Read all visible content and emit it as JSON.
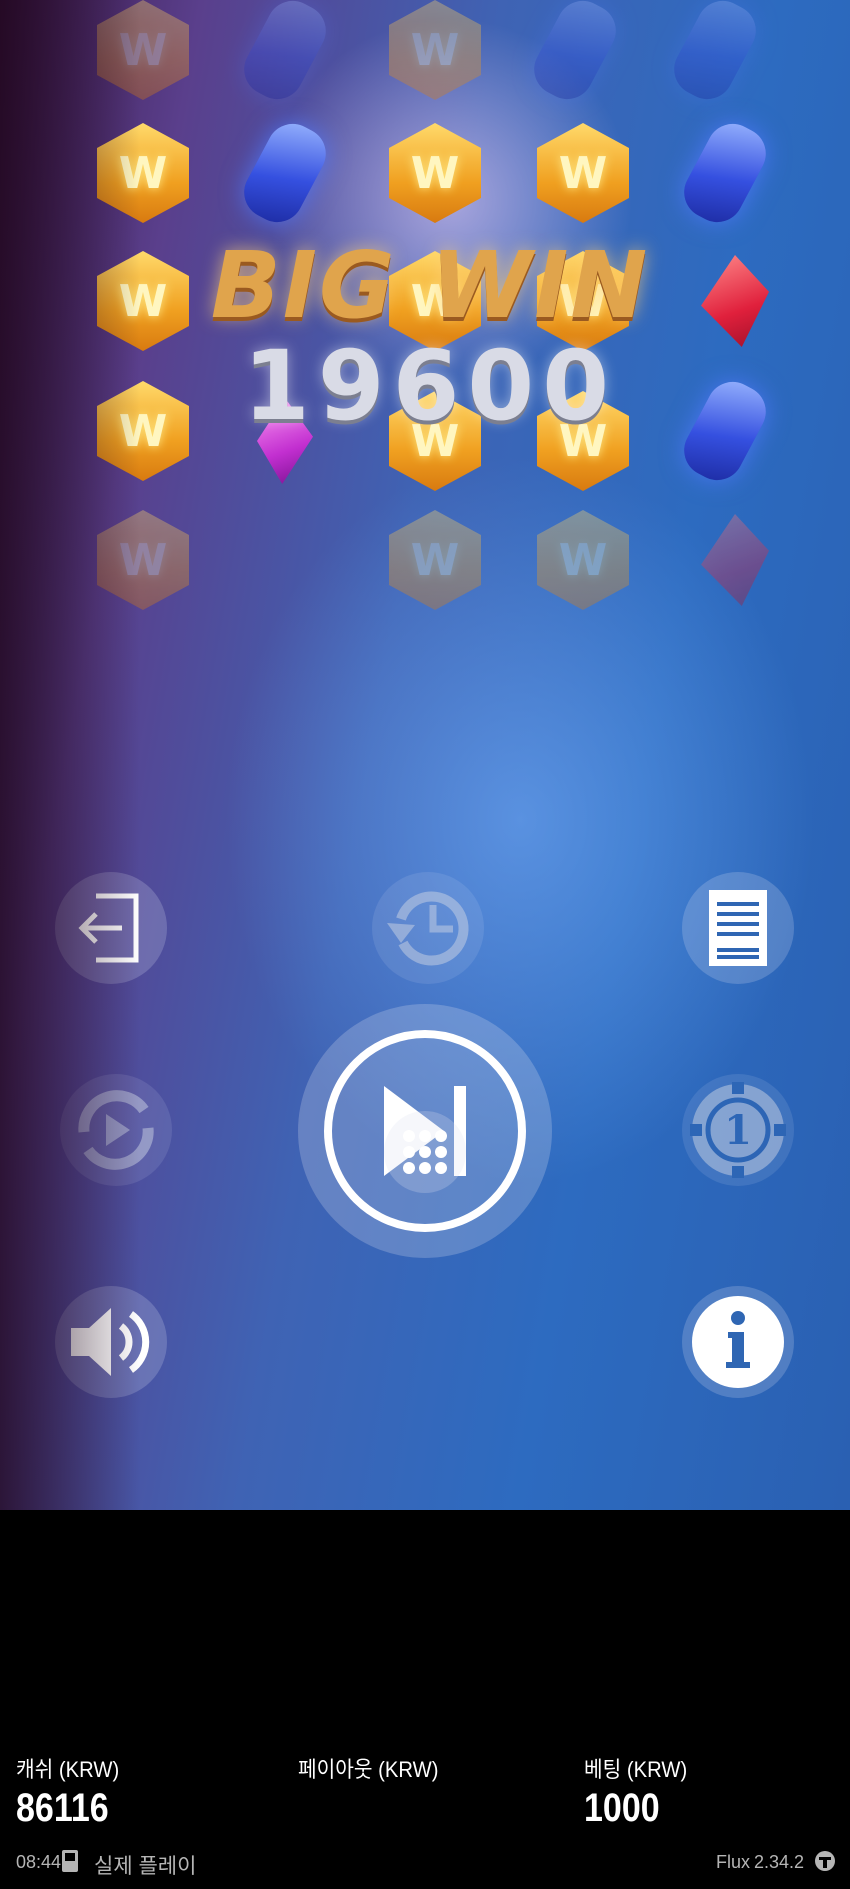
{
  "win_banner": {
    "title": "BIG WIN",
    "amount": "19600"
  },
  "reel_symbols": [
    {
      "name": "wild-symbol",
      "label": "W"
    }
  ],
  "controls": [
    {
      "name": "exit-button",
      "icon": "exit-icon"
    },
    {
      "name": "history-button",
      "icon": "history-clock-icon"
    },
    {
      "name": "paytable-button",
      "icon": "document-icon"
    },
    {
      "name": "autoplay-button",
      "icon": "autoplay-icon"
    },
    {
      "name": "skip-button",
      "icon": "skip-forward-icon"
    },
    {
      "name": "bet-button",
      "icon": "chip-icon"
    },
    {
      "name": "sound-button",
      "icon": "speaker-icon"
    },
    {
      "name": "menu-button",
      "icon": "grid-dots-icon"
    },
    {
      "name": "info-button",
      "icon": "info-icon"
    }
  ],
  "stats": {
    "cash_label": "캐쉬 (KRW)",
    "cash_value": "86116",
    "payout_label": "페이아웃 (KRW)",
    "payout_value": "",
    "bet_label": "베팅 (KRW)",
    "bet_value": "1000"
  },
  "footer": {
    "time": "08:44",
    "mode": "실제 플레이",
    "brand": "Flux",
    "version": "2.34.2"
  },
  "colors": {
    "accent_blue": "#2d6bc0",
    "icon_blue": "#2f66b3",
    "gold": "#e0a44c"
  }
}
